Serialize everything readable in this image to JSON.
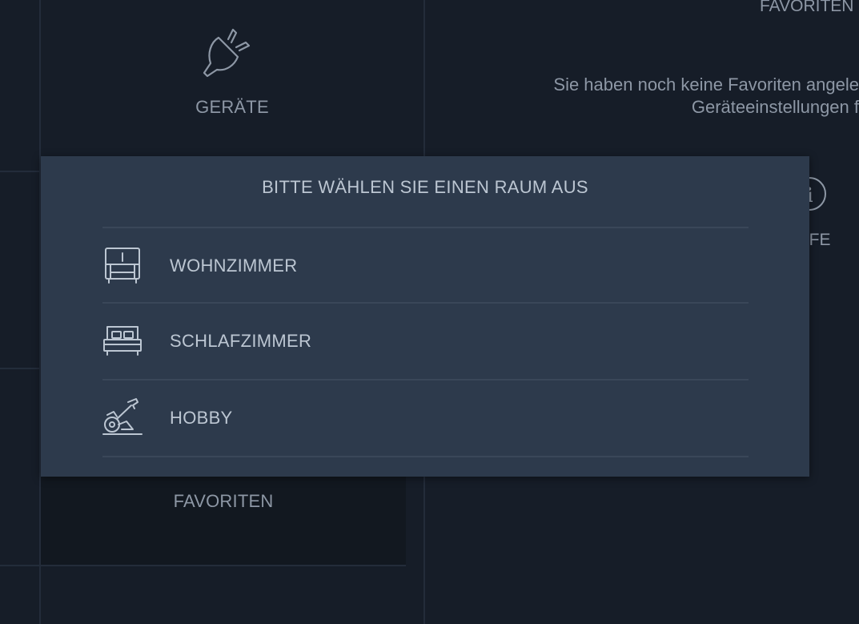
{
  "tiles": {
    "devices_label": "GERÄTE",
    "favorites_label": "FAVORITEN",
    "devices_icon": "plug-icon"
  },
  "right_panel": {
    "header": "FAVORITEN",
    "empty_line1": "Sie haben noch keine Favoriten angele",
    "empty_line2": "Geräteeinstellungen f",
    "help_label": "LFE",
    "help_icon": "info-icon"
  },
  "room_dialog": {
    "title": "BITTE WÄHLEN SIE EINEN RAUM AUS",
    "rooms": [
      {
        "label": "WOHNZIMMER",
        "icon": "armchair-icon"
      },
      {
        "label": "SCHLAFZIMMER",
        "icon": "bed-icon"
      },
      {
        "label": "HOBBY",
        "icon": "exercise-bike-icon"
      }
    ]
  },
  "colors": {
    "background": "#161d28",
    "dialog": "#2d3a4c",
    "text": "#bcc6d2",
    "muted_text": "#8d97a5"
  }
}
